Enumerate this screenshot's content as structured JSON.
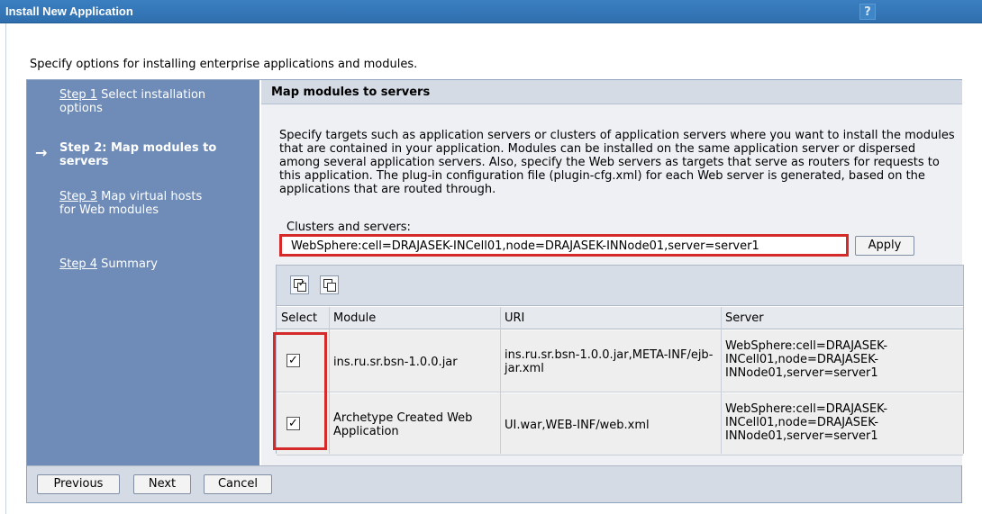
{
  "window": {
    "title": "Install New Application",
    "help": "?"
  },
  "intro": "Specify options for installing enterprise applications and modules.",
  "steps": [
    {
      "link": "Step 1",
      "text": " Select installation options"
    },
    {
      "label": "Step 2: Map modules to servers",
      "current": true
    },
    {
      "link": "Step 3",
      "text": " Map virtual hosts for Web modules"
    },
    {
      "link": "Step 4",
      "text": " Summary"
    }
  ],
  "current_marker": "→",
  "panel": {
    "heading": "Map modules to servers",
    "description": "Specify targets such as application servers or clusters of application servers where you want to install the modules that are contained in your application. Modules can be installed on the same application server or dispersed among several application servers. Also, specify the Web servers as targets that serve as routers for requests to this application. The plug-in configuration file (plugin-cfg.xml) for each Web server is generated, based on the applications that are routed through.",
    "clusters_label": "Clusters and servers:",
    "clusters_value": "WebSphere:cell=DRAJASEK-INCell01,node=DRAJASEK-INNode01,server=server1",
    "apply_label": "Apply"
  },
  "table": {
    "toolbar_icons": [
      "select-all-icon",
      "deselect-all-icon"
    ],
    "columns": [
      "Select",
      "Module",
      "URI",
      "Server"
    ],
    "rows": [
      {
        "checked": "✓",
        "module": "ins.ru.sr.bsn-1.0.0.jar",
        "uri": "ins.ru.sr.bsn-1.0.0.jar,META-INF/ejb-jar.xml",
        "server": "WebSphere:cell=DRAJASEK-INCell01,node=DRAJASEK-INNode01,server=server1"
      },
      {
        "checked": "✓",
        "module": "Archetype Created Web Application",
        "uri": "UI.war,WEB-INF/web.xml",
        "server": "WebSphere:cell=DRAJASEK-INCell01,node=DRAJASEK-INNode01,server=server1"
      }
    ]
  },
  "buttons": {
    "previous": "Previous",
    "next": "Next",
    "cancel": "Cancel"
  },
  "colors": {
    "title_bar": "#2f6fae",
    "steps_panel": "#6e8cb7",
    "highlight": "#d42a2a"
  }
}
